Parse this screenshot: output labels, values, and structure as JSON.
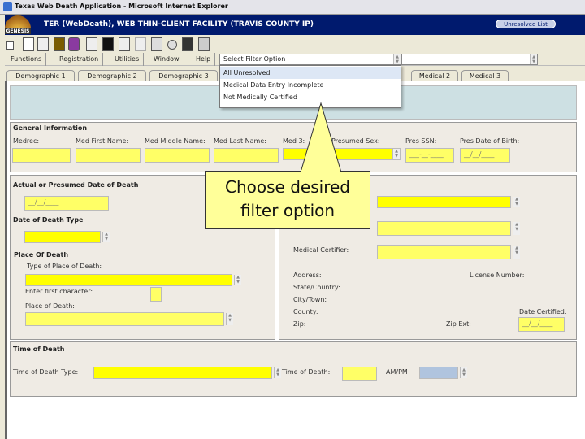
{
  "window": {
    "title": "Texas Web Death Application - Microsoft Internet Explorer"
  },
  "header": {
    "logo": "GENESIS",
    "title": "TER (WebDeath), WEB THIN-CLIENT FACILITY (TRAVIS COUNTY IP)",
    "unresolved_button": "Unresolved List"
  },
  "menu": {
    "items": [
      "Functions",
      "Registration",
      "Utilities",
      "Window",
      "Help"
    ]
  },
  "filter": {
    "value": "Select Filter Option",
    "options": [
      "All Unresolved",
      "Medical Data Entry Incomplete",
      "Not Medically Certified"
    ]
  },
  "tabs": [
    "Demographic 1",
    "Demographic 2",
    "Demographic 3",
    "Medical 2",
    "Medical 3"
  ],
  "general": {
    "heading": "General Information",
    "labels": [
      "Medrec:",
      "Med First Name:",
      "Med Middle Name:",
      "Med Last Name:",
      "Med 3:",
      "Presumed Sex:",
      "Pres SSN:",
      "Pres Date of Birth:"
    ],
    "ssn_mask": "___-__-____",
    "dob_mask": "__/__/____"
  },
  "death": {
    "date_heading": "Actual or Presumed Date of Death",
    "date_mask": "__/__/____",
    "type_heading": "Date of Death Type",
    "place_heading": "Place Of Death",
    "place_type": "Type of Place of Death:",
    "first_char": "Enter first character:",
    "place": "Place of Death:"
  },
  "certifier": {
    "medical_certifier": "Medical Certifier:",
    "address": "Address:",
    "license": "License Number:",
    "state": "State/Country:",
    "city": "City/Town:",
    "county": "County:",
    "date_certified": "Date Certified:",
    "zip": "Zip:",
    "zip_ext": "Zip Ext:",
    "date_mask": "__/__/____"
  },
  "time": {
    "heading": "Time of Death",
    "type": "Time of Death Type:",
    "time": "Time of Death:",
    "ampm": "AM/PM"
  },
  "callout": {
    "line1": "Choose desired",
    "line2": "filter option"
  },
  "colors": {
    "header": "#001a6e",
    "field": "#ffff00",
    "band": "#cde0e3",
    "callout": "#ffff99"
  }
}
